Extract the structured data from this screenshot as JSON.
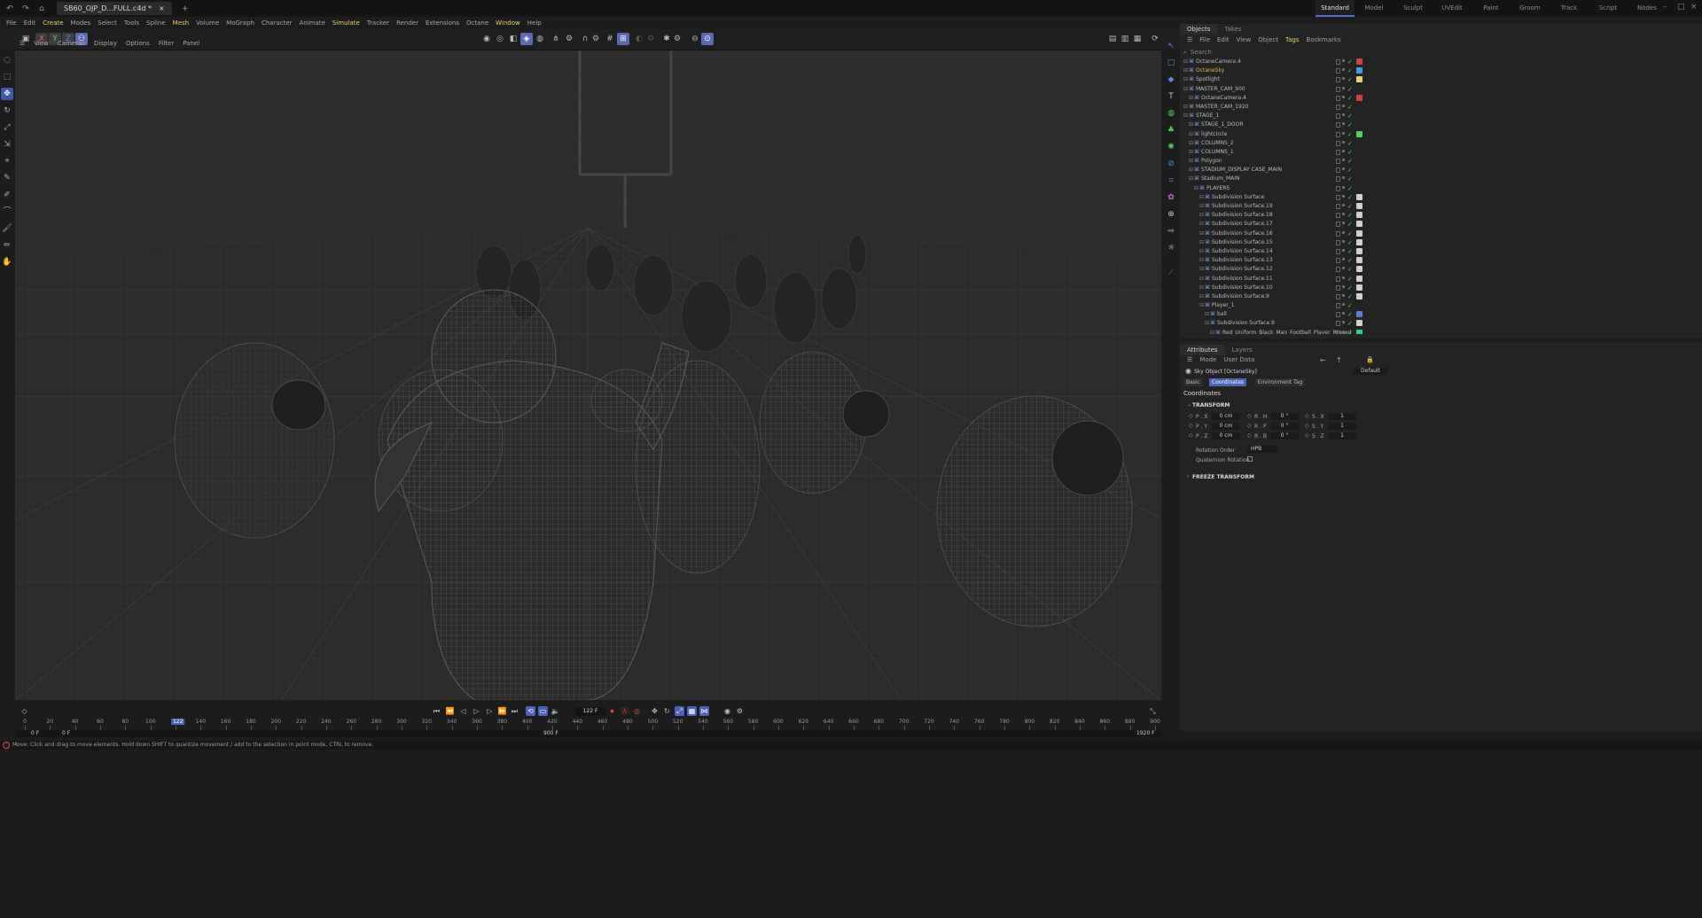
{
  "titlebar": {
    "doc_tab": "SB60_OJP_D...FULL.c4d *",
    "layouts": [
      "Standard",
      "Model",
      "Sculpt",
      "UVEdit",
      "Paint",
      "Groom",
      "Track",
      "Script",
      "Nodes"
    ]
  },
  "menubar": [
    {
      "label": "File",
      "hl": false
    },
    {
      "label": "Edit",
      "hl": false
    },
    {
      "label": "Create",
      "hl": true
    },
    {
      "label": "Modes",
      "hl": false
    },
    {
      "label": "Select",
      "hl": false
    },
    {
      "label": "Tools",
      "hl": false
    },
    {
      "label": "Spline",
      "hl": false
    },
    {
      "label": "Mesh",
      "hl": true
    },
    {
      "label": "Volume",
      "hl": false
    },
    {
      "label": "MoGraph",
      "hl": false
    },
    {
      "label": "Character",
      "hl": false
    },
    {
      "label": "Animate",
      "hl": false
    },
    {
      "label": "Simulate",
      "hl": true
    },
    {
      "label": "Tracker",
      "hl": false
    },
    {
      "label": "Render",
      "hl": false
    },
    {
      "label": "Extensions",
      "hl": false
    },
    {
      "label": "Octane",
      "hl": false
    },
    {
      "label": "Window",
      "hl": true
    },
    {
      "label": "Help",
      "hl": false
    }
  ],
  "axis_buttons": {
    "x": "X",
    "y": "Y",
    "z": "Z"
  },
  "viewport_menu": [
    "View",
    "Cameras",
    "Display",
    "Options",
    "Filter",
    "Panel"
  ],
  "objects_panel": {
    "tabs": [
      "Objects",
      "Takes"
    ],
    "menu": [
      {
        "label": "File",
        "hl": false
      },
      {
        "label": "Edit",
        "hl": false
      },
      {
        "label": "View",
        "hl": false
      },
      {
        "label": "Object",
        "hl": false
      },
      {
        "label": "Tags",
        "hl": true
      },
      {
        "label": "Bookmarks",
        "hl": false
      }
    ],
    "search_placeholder": "Search",
    "rows": [
      {
        "label": "OctaneCamera.4",
        "indent": 0,
        "color": "#bcbcbc",
        "tag": "#d04040"
      },
      {
        "label": "OctaneSky",
        "indent": 0,
        "color": "#e2b94a",
        "tag": "#3aa0e0"
      },
      {
        "label": "Spotlight",
        "indent": 0,
        "color": "#bcbcbc",
        "tag": "#e8d36a"
      },
      {
        "label": "MASTER_CAM_900",
        "indent": 0,
        "color": "#bcbcbc",
        "tag": ""
      },
      {
        "label": "OctaneCamera.4",
        "indent": 1,
        "color": "#bcbcbc",
        "tag": "#d04040"
      },
      {
        "label": "MASTER_CAM_1920",
        "indent": 0,
        "color": "#bcbcbc",
        "tag": ""
      },
      {
        "label": "STAGE_1",
        "indent": 0,
        "color": "#bcbcbc",
        "tag": ""
      },
      {
        "label": "STAGE_1_DOOR",
        "indent": 1,
        "color": "#bcbcbc",
        "tag": ""
      },
      {
        "label": "lightcircle",
        "indent": 1,
        "color": "#bcbcbc",
        "tag": "#4cd35a"
      },
      {
        "label": "COLUMNS_2",
        "indent": 1,
        "color": "#bcbcbc",
        "tag": ""
      },
      {
        "label": "COLUMNS_1",
        "indent": 1,
        "color": "#bcbcbc",
        "tag": ""
      },
      {
        "label": "Polygon",
        "indent": 1,
        "color": "#bcbcbc",
        "tag": ""
      },
      {
        "label": "STADIUM_DISPLAY CASE_MAIN",
        "indent": 1,
        "color": "#bcbcbc",
        "tag": ""
      },
      {
        "label": "Stadium_MAIN",
        "indent": 1,
        "color": "#bcbcbc",
        "tag": ""
      },
      {
        "label": "PLAYERS",
        "indent": 2,
        "color": "#bcbcbc",
        "tag": ""
      },
      {
        "label": "Subdivision Surface",
        "indent": 3,
        "color": "#bcbcbc",
        "tag": "#cfcfcf"
      },
      {
        "label": "Subdivision Surface.19",
        "indent": 3,
        "color": "#bcbcbc",
        "tag": "#cfcfcf"
      },
      {
        "label": "Subdivision Surface.18",
        "indent": 3,
        "color": "#bcbcbc",
        "tag": "#cfcfcf"
      },
      {
        "label": "Subdivision Surface.17",
        "indent": 3,
        "color": "#bcbcbc",
        "tag": "#cfcfcf"
      },
      {
        "label": "Subdivision Surface.16",
        "indent": 3,
        "color": "#bcbcbc",
        "tag": "#cfcfcf"
      },
      {
        "label": "Subdivision Surface.15",
        "indent": 3,
        "color": "#bcbcbc",
        "tag": "#cfcfcf"
      },
      {
        "label": "Subdivision Surface.14",
        "indent": 3,
        "color": "#bcbcbc",
        "tag": "#cfcfcf"
      },
      {
        "label": "Subdivision Surface.13",
        "indent": 3,
        "color": "#bcbcbc",
        "tag": "#cfcfcf"
      },
      {
        "label": "Subdivision Surface.12",
        "indent": 3,
        "color": "#bcbcbc",
        "tag": "#cfcfcf"
      },
      {
        "label": "Subdivision Surface.11",
        "indent": 3,
        "color": "#bcbcbc",
        "tag": "#cfcfcf"
      },
      {
        "label": "Subdivision Surface.10",
        "indent": 3,
        "color": "#bcbcbc",
        "tag": "#cfcfcf"
      },
      {
        "label": "Subdivision Surface.9",
        "indent": 3,
        "color": "#bcbcbc",
        "tag": "#cfcfcf"
      },
      {
        "label": "Player_1",
        "indent": 3,
        "color": "#bcbcbc",
        "tag": ""
      },
      {
        "label": "ball",
        "indent": 4,
        "color": "#bcbcbc",
        "tag": "#5b7bd5"
      },
      {
        "label": "Subdivision Surface.9",
        "indent": 4,
        "color": "#bcbcbc",
        "tag": "#cfcfcf"
      },
      {
        "label": "Red_Uniform_Black_Man_Football_Player_Rigged",
        "indent": 5,
        "color": "#bcbcbc",
        "tag": "#2fd08a"
      }
    ]
  },
  "attributes_panel": {
    "tabs": [
      "Attributes",
      "Layers"
    ],
    "menu": [
      "Mode",
      "User Data"
    ],
    "object_name": "Sky Object [OctaneSky]",
    "preset": "Default",
    "subtabs": [
      {
        "label": "Basic",
        "active": false
      },
      {
        "label": "Coordinates",
        "active": true
      },
      {
        "label": "Environment Tag",
        "active": false
      }
    ],
    "section": "Coordinates",
    "transform_title": "TRANSFORM",
    "fields": [
      {
        "p_label": "P . X",
        "p_val": "0 cm",
        "r_label": "R . H",
        "r_val": "0 °",
        "s_label": "S . X",
        "s_val": "1"
      },
      {
        "p_label": "P . Y",
        "p_val": "0 cm",
        "r_label": "R . P",
        "r_val": "0 °",
        "s_label": "S . Y",
        "s_val": "1"
      },
      {
        "p_label": "P . Z",
        "p_val": "0 cm",
        "r_label": "R . B",
        "r_val": "0 °",
        "s_label": "S . Z",
        "s_val": "1"
      }
    ],
    "rotation_order_label": "Rotation Order",
    "rotation_order": "HPB",
    "quaternion_label": "Quaternion Rotation",
    "freeze_title": "FREEZE TRANSFORM"
  },
  "timeline": {
    "current_frame": "122 F",
    "playhead_frame": 122,
    "ticks": [
      0,
      20,
      40,
      60,
      80,
      100,
      120,
      140,
      160,
      180,
      200,
      220,
      240,
      260,
      280,
      300,
      320,
      340,
      360,
      380,
      400,
      420,
      440,
      460,
      480,
      500,
      520,
      540,
      560,
      580,
      600,
      620,
      640,
      660,
      680,
      700,
      720,
      740,
      760,
      780,
      800,
      820,
      840,
      860,
      880,
      900
    ],
    "playhead_label": "122",
    "start_field": "0 F",
    "min_field": "0 F",
    "mid_label": "900 F",
    "end_field": "1920 F"
  },
  "status": "Move: Click and drag to move elements. Hold down SHIFT to quantize movement / add to the selection in point mode, CTRL to remove."
}
